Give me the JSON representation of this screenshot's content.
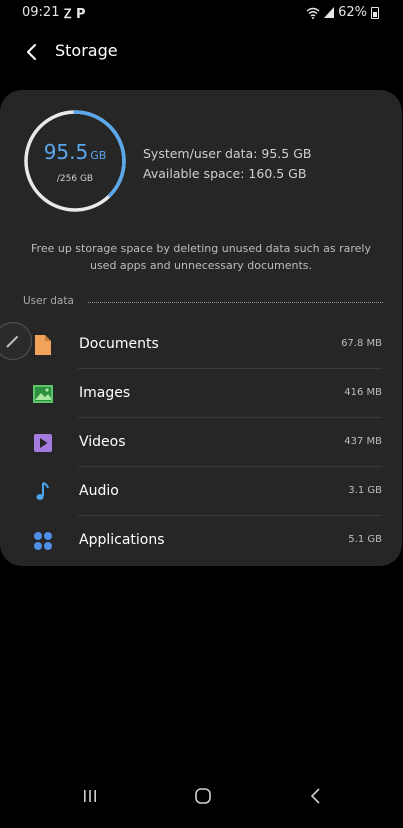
{
  "status_bar": {
    "time": "09:21",
    "left_icons": "Ⴭ P",
    "battery": "62%"
  },
  "header": {
    "title": "Storage"
  },
  "storage": {
    "used_value": "95.5",
    "used_unit": "GB",
    "total": "/256 GB",
    "used_fraction": 0.373,
    "system_line": "System/user data: 95.5 GB",
    "available_line": "Available space: 160.5 GB",
    "accent_color": "#5aa7ec"
  },
  "tip": "Free up storage space by deleting unused data such as rarely used apps and unnecessary documents.",
  "section": {
    "label": "User data"
  },
  "items": [
    {
      "label": "Documents",
      "size": "67.8 MB",
      "icon": "document-icon",
      "color": "#f2a35b"
    },
    {
      "label": "Images",
      "size": "416 MB",
      "icon": "image-icon",
      "color": "#5cc46b"
    },
    {
      "label": "Videos",
      "size": "437 MB",
      "icon": "video-icon",
      "color": "#a57be0"
    },
    {
      "label": "Audio",
      "size": "3.1 GB",
      "icon": "music-note-icon",
      "color": "#4fa3ec"
    },
    {
      "label": "Applications",
      "size": "5.1 GB",
      "icon": "apps-grid-icon",
      "color": "#4f8fe5"
    }
  ]
}
